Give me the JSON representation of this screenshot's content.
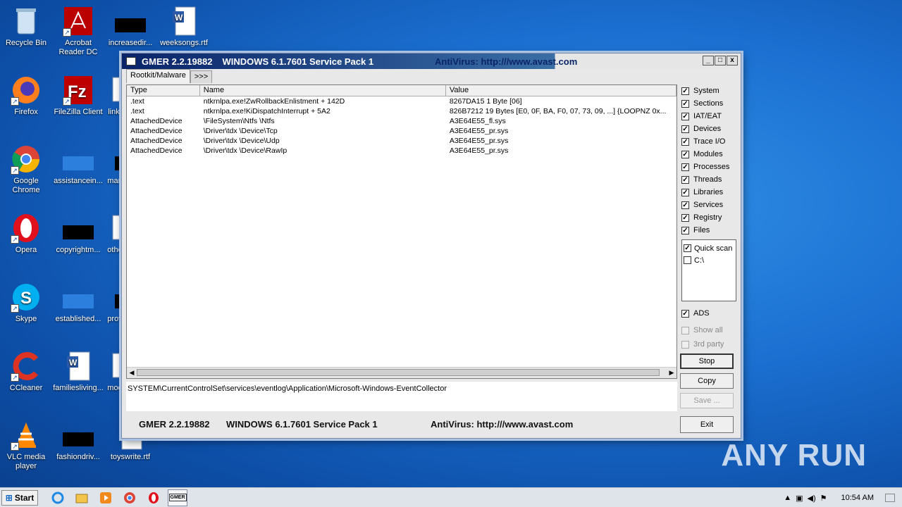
{
  "desktop": {
    "icons": [
      {
        "label": "Recycle Bin"
      },
      {
        "label": "Acrobat Reader DC"
      },
      {
        "label": "increasedir..."
      },
      {
        "label": "weeksongs.rtf"
      },
      {
        "label": "Firefox"
      },
      {
        "label": "FileZilla Client"
      },
      {
        "label": "linkt"
      },
      {
        "label": "Google Chrome"
      },
      {
        "label": "assistancein..."
      },
      {
        "label": "marl"
      },
      {
        "label": "Opera"
      },
      {
        "label": "copyrightm..."
      },
      {
        "label": "othe"
      },
      {
        "label": "Skype"
      },
      {
        "label": "established..."
      },
      {
        "label": "prov"
      },
      {
        "label": "CCleaner"
      },
      {
        "label": "familiesliving..."
      },
      {
        "label": "mod"
      },
      {
        "label": "VLC media player"
      },
      {
        "label": "fashiondriv..."
      },
      {
        "label": "toyswrite.rtf"
      }
    ]
  },
  "window": {
    "title_app": "GMER 2.2.19882",
    "title_os": "WINDOWS 6.1.7601 Service Pack 1",
    "title_av": "AntiVirus: http:///www.avast.com",
    "controls": {
      "minimize": "_",
      "maximize": "□",
      "close": "x"
    },
    "tabs": [
      "Rootkit/Malware",
      ">>>"
    ],
    "columns": [
      "Type",
      "Name",
      "Value"
    ],
    "rows": [
      {
        "type": ".text",
        "name": "ntkrnlpa.exe!ZwRollbackEnlistment + 142D",
        "value": "8267DA15 1 Byte  [06]"
      },
      {
        "type": ".text",
        "name": "ntkrnlpa.exe!KiDispatchInterrupt + 5A2",
        "value": "826B7212 19 Bytes  [E0, 0F, BA, F0, 07, 73, 09, ...] {LOOPNZ 0x..."
      },
      {
        "type": "AttachedDevice",
        "name": "\\FileSystem\\Ntfs \\Ntfs",
        "value": "A3E64E55_fl.sys"
      },
      {
        "type": "AttachedDevice",
        "name": "\\Driver\\tdx \\Device\\Tcp",
        "value": "A3E64E55_pr.sys"
      },
      {
        "type": "AttachedDevice",
        "name": "\\Driver\\tdx \\Device\\Udp",
        "value": "A3E64E55_pr.sys"
      },
      {
        "type": "AttachedDevice",
        "name": "\\Driver\\tdx \\Device\\RawIp",
        "value": "A3E64E55_pr.sys"
      }
    ],
    "current_path": "SYSTEM\\CurrentControlSet\\services\\eventlog\\Application\\Microsoft-Windows-EventCollector",
    "options": [
      "System",
      "Sections",
      "IAT/EAT",
      "Devices",
      "Trace I/O",
      "Modules",
      "Processes",
      "Threads",
      "Libraries",
      "Services",
      "Registry",
      "Files"
    ],
    "scan_targets": [
      {
        "label": "Quick scan",
        "checked": true
      },
      {
        "label": "C:\\",
        "checked": false
      }
    ],
    "ads_label": "ADS",
    "show_all_label": "Show all",
    "third_party_label": "3rd party",
    "buttons": {
      "stop": "Stop",
      "copy": "Copy",
      "save": "Save ...",
      "exit": "Exit"
    },
    "status": {
      "app": "GMER 2.2.19882",
      "os": "WINDOWS 6.1.7601 Service Pack 1",
      "av": "AntiVirus: http:///www.avast.com"
    }
  },
  "taskbar": {
    "start_label": "Start",
    "clock": "10:54 AM",
    "active_app_label": "GMER"
  },
  "watermark": "ANY RUN"
}
